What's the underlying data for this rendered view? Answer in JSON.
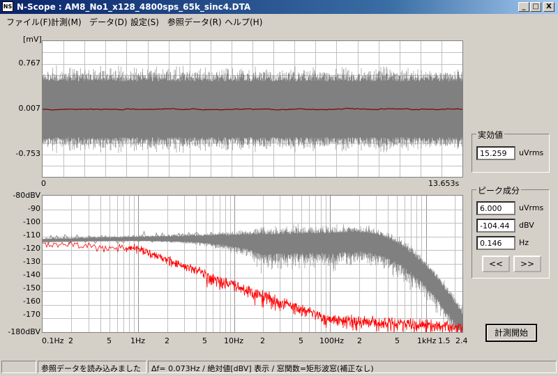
{
  "window": {
    "icon_text": "NS",
    "title": "N-Scope : AM8_No1_x128_4800sps_65k_sinc4.DTA",
    "min_symbol": "_",
    "max_symbol": "□",
    "close_symbol": "X"
  },
  "menu": [
    {
      "label": "ファイル(F)"
    },
    {
      "label": "計測(M)"
    },
    {
      "label": "データ(D)"
    },
    {
      "label": "設定(S)"
    },
    {
      "label": "参照データ(R)"
    },
    {
      "label": "ヘルプ(H)"
    }
  ],
  "time_plot": {
    "unit_label": "[mV]",
    "y_ticks": [
      "0.767",
      "0.007",
      "-0.753"
    ],
    "x_start": "0",
    "x_end": "13.653s",
    "colors": {
      "signal": "#808080",
      "reference": "#800000",
      "grid": "#c0c0c0"
    }
  },
  "freq_plot": {
    "y_ticks": [
      "-80dBV",
      "-90",
      "-100",
      "-110",
      "-120",
      "-130",
      "-140",
      "-150",
      "-160",
      "-170",
      "-180dBV"
    ],
    "x_ticks": [
      "0.1Hz",
      "2",
      "5",
      "1Hz",
      "2",
      "5",
      "10Hz",
      "2",
      "5",
      "100Hz",
      "2",
      "5",
      "1kHz",
      "1.5",
      "2.4"
    ],
    "colors": {
      "spectrum": "#808080",
      "reference": "#ff0000",
      "grid": "#c0c0c0"
    }
  },
  "rms_panel": {
    "title": "実効値",
    "value": "15.259",
    "unit": "uVrms"
  },
  "peak_panel": {
    "title": "ピーク成分",
    "amplitude": "6.000",
    "amplitude_unit": "uVrms",
    "level": "-104.44",
    "level_unit": "dBV",
    "frequency": "0.146",
    "frequency_unit": "Hz",
    "prev_label": "<<",
    "next_label": ">>"
  },
  "start_button": "計測開始",
  "status": {
    "message": "参照データを読み込みました",
    "info": "Δf= 0.073Hz / 絶対値[dBV] 表示 / 窓関数=矩形波窓(補正なし)"
  }
}
